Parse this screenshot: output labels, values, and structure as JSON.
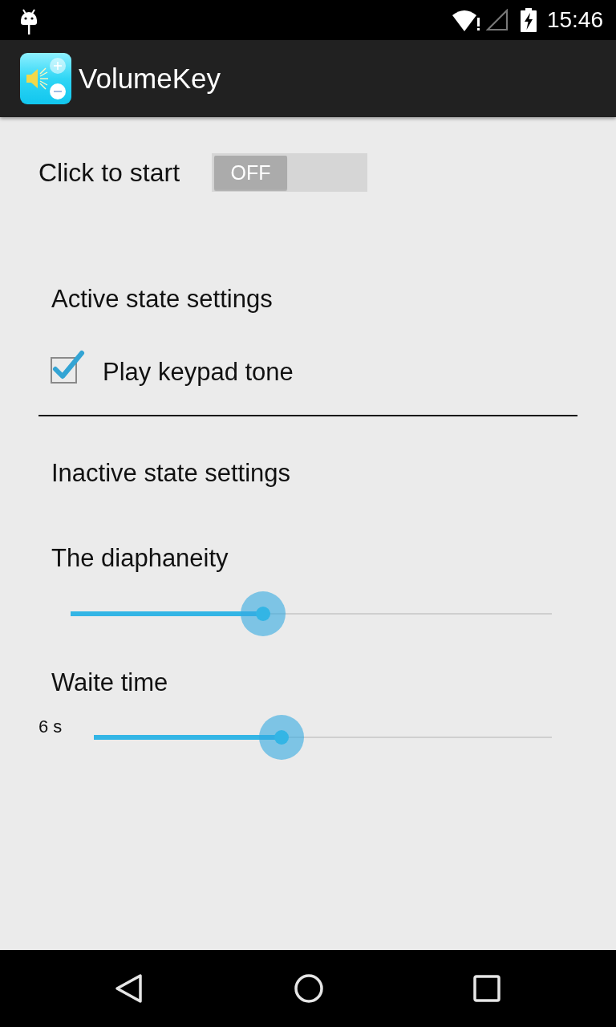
{
  "status_bar": {
    "time": "15:46"
  },
  "app_bar": {
    "title": "VolumeKey"
  },
  "start_row": {
    "label": "Click to start",
    "toggle": {
      "label": "OFF",
      "on": false
    }
  },
  "active_section": {
    "title": "Active state settings",
    "options": [
      {
        "label": "Play keypad tone",
        "checked": true
      }
    ]
  },
  "inactive_section": {
    "title": "Inactive state settings",
    "sliders": [
      {
        "label": "The diaphaneity",
        "level": 0.4
      },
      {
        "label": "Waite time",
        "reading": "6 s",
        "level": 0.41
      }
    ]
  }
}
